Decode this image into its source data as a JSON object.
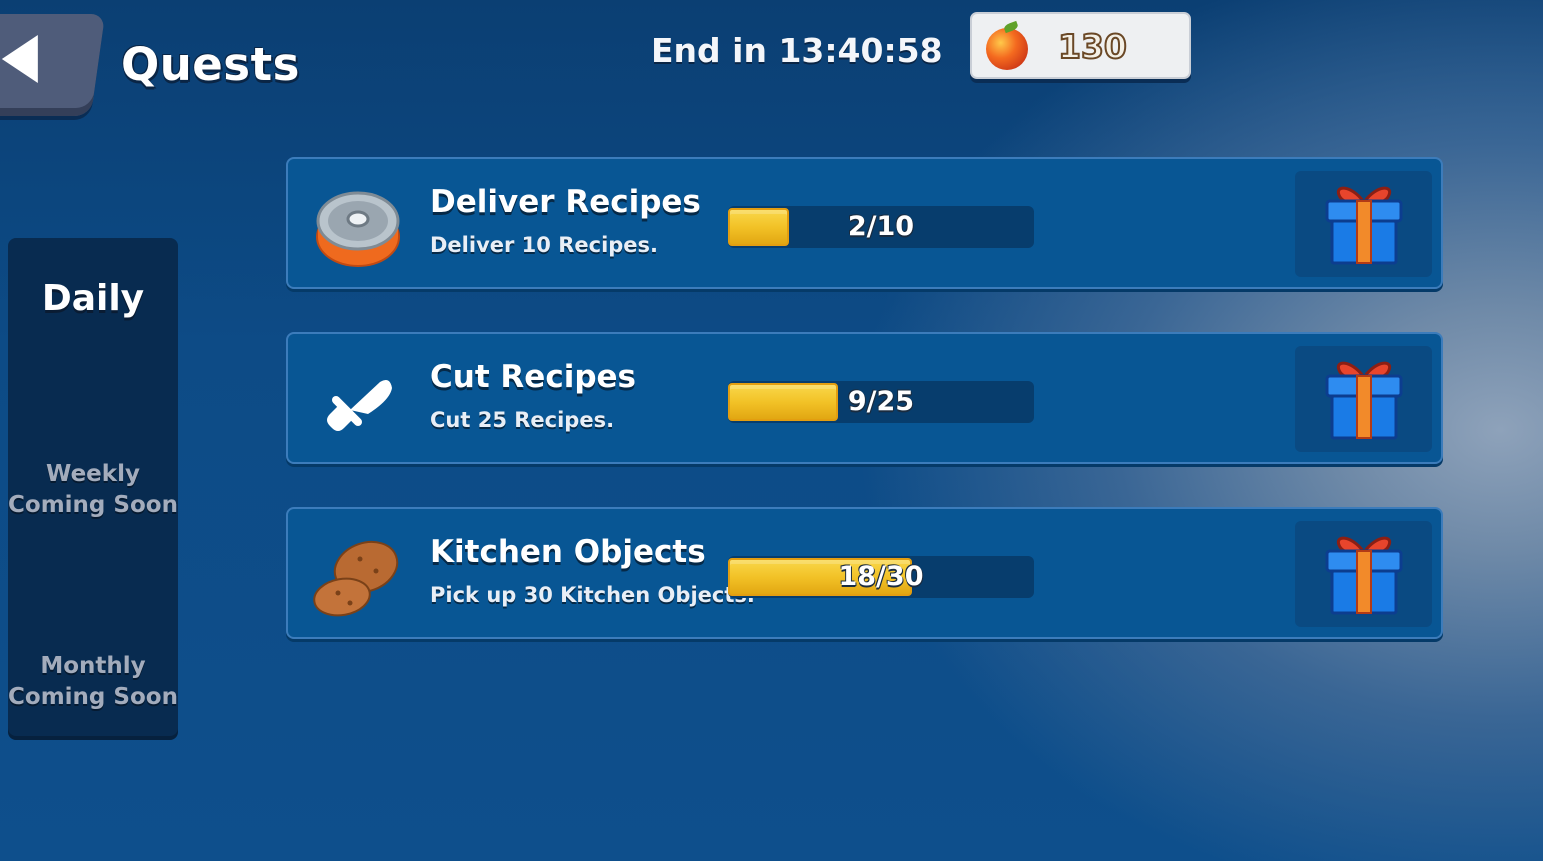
{
  "header": {
    "title": "Quests",
    "timer": "End in 13:40:58",
    "currency": {
      "icon": "apple-icon",
      "value": "130"
    }
  },
  "tabs": {
    "daily": "Daily",
    "weekly": {
      "label": "Weekly",
      "status": "Coming Soon"
    },
    "monthly": {
      "label": "Monthly",
      "status": "Coming Soon"
    }
  },
  "quests": [
    {
      "title": "Deliver Recipes",
      "description": "Deliver 10 Recipes.",
      "progress_text": "2/10",
      "current": 2,
      "target": 10,
      "icon": "tin-can-icon",
      "reward_icon": "gift-icon"
    },
    {
      "title": "Cut Recipes",
      "description": "Cut 25 Recipes.",
      "progress_text": "9/25",
      "current": 9,
      "target": 25,
      "icon": "knife-icon",
      "reward_icon": "gift-icon"
    },
    {
      "title": "Kitchen Objects",
      "description": "Pick up 30 Kitchen Objects.",
      "progress_text": "18/30",
      "current": 18,
      "target": 30,
      "icon": "potato-icon",
      "reward_icon": "gift-icon"
    }
  ],
  "colors": {
    "progress_fill": "#f2c227",
    "panel": "#085694",
    "gift_box": "#1a7be6",
    "gift_ribbon": "#e8452c"
  }
}
